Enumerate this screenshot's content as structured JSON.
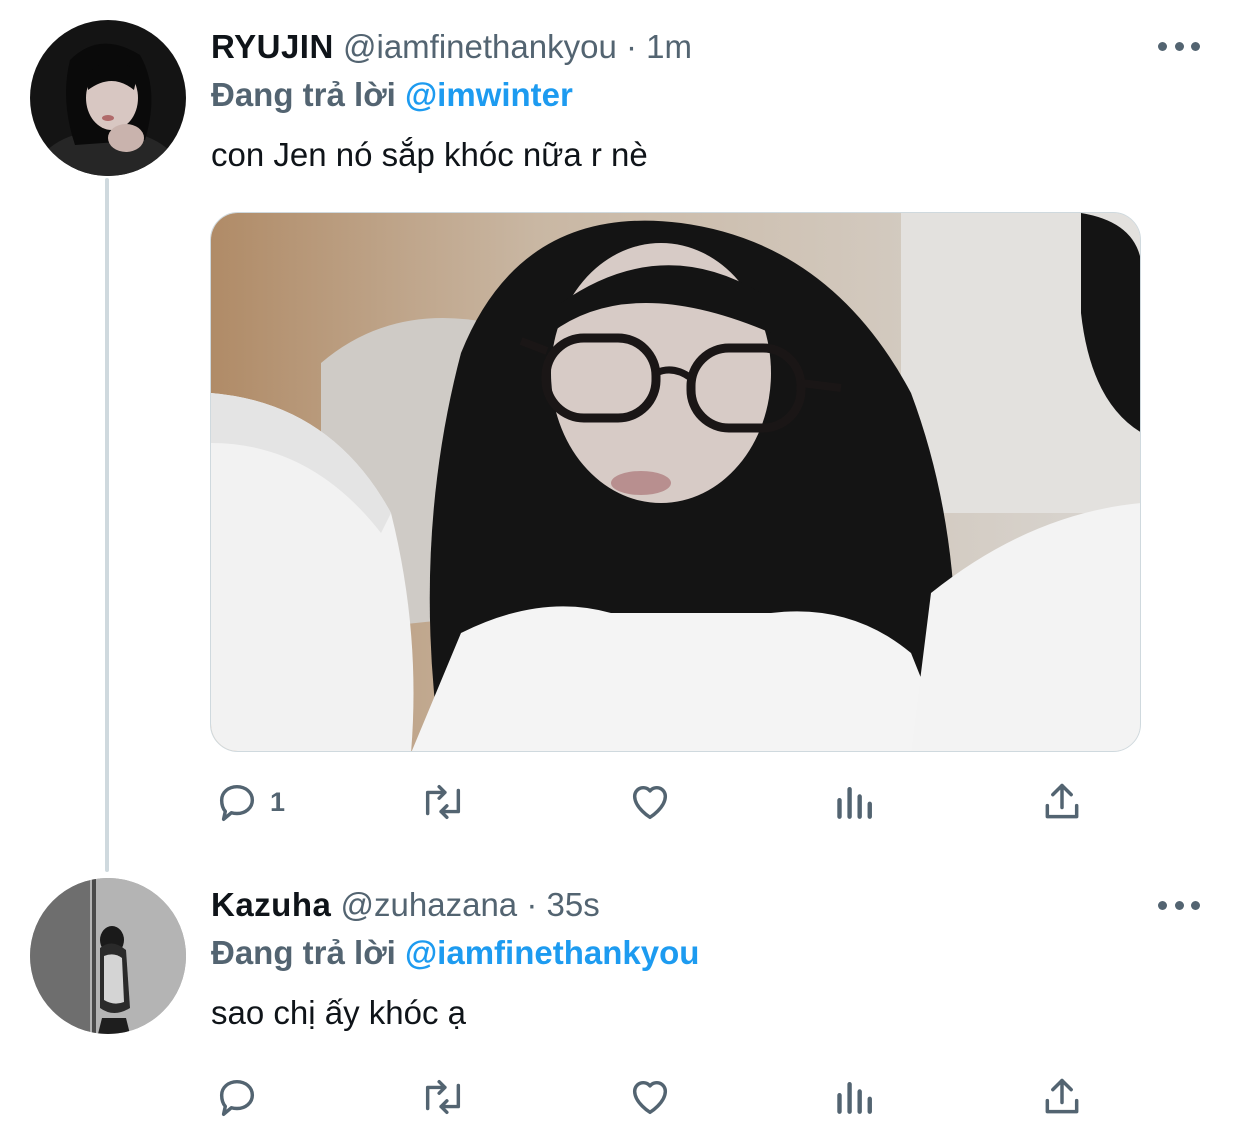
{
  "tweets": [
    {
      "display_name": "RYUJIN",
      "handle": "@iamfinethankyou",
      "separator": "·",
      "time": "1m",
      "reply_label": "Đang trả lời",
      "reply_to": "@imwinter",
      "text": "con Jen nó sắp khóc nữa r nè",
      "reply_count": "1",
      "icons": [
        "reply-icon",
        "retweet-icon",
        "like-icon",
        "analytics-icon",
        "share-icon",
        "more-icon"
      ]
    },
    {
      "display_name": "Kazuha",
      "handle": "@zuhazana",
      "separator": "·",
      "time": "35s",
      "reply_label": "Đang trả lời",
      "reply_to": "@iamfinethankyou",
      "text": "sao chị ấy khóc ạ",
      "reply_count": "",
      "icons": [
        "reply-icon",
        "retweet-icon",
        "like-icon",
        "analytics-icon",
        "share-icon",
        "more-icon"
      ]
    }
  ],
  "colors": {
    "text_primary": "#0f1419",
    "text_secondary": "#536471",
    "link": "#1d9bf0",
    "thread_line": "#cfd9de"
  }
}
